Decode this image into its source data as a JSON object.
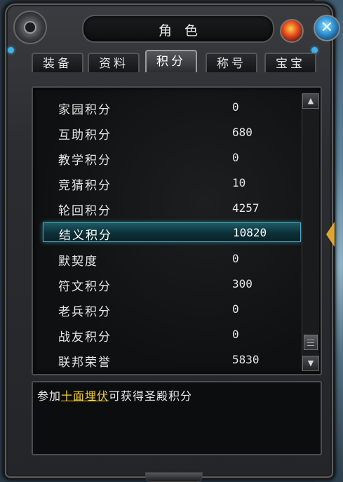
{
  "window": {
    "title": "角色"
  },
  "tabs": [
    {
      "label": "装备",
      "active": false
    },
    {
      "label": "资料",
      "active": false
    },
    {
      "label": "积分",
      "active": true
    },
    {
      "label": "称号",
      "active": false
    },
    {
      "label": "宝宝",
      "active": false
    }
  ],
  "scores": [
    {
      "label": "家园积分",
      "value": "0"
    },
    {
      "label": "互助积分",
      "value": "680"
    },
    {
      "label": "教学积分",
      "value": "0"
    },
    {
      "label": "竞猜积分",
      "value": "10"
    },
    {
      "label": "轮回积分",
      "value": "4257"
    },
    {
      "label": "结义积分",
      "value": "10820",
      "selected": true
    },
    {
      "label": "默契度",
      "value": "0"
    },
    {
      "label": "符文积分",
      "value": "300"
    },
    {
      "label": "老兵积分",
      "value": "0"
    },
    {
      "label": "战友积分",
      "value": "0"
    },
    {
      "label": "联邦荣誉",
      "value": "5830"
    }
  ],
  "description": {
    "prefix": "参加",
    "link": "十面埋伏",
    "suffix": "可获得圣殿积分"
  },
  "colors": {
    "link": "#f2d23a",
    "selected_row": "#1d5a66",
    "accent_gem": "#3fb3e6"
  }
}
